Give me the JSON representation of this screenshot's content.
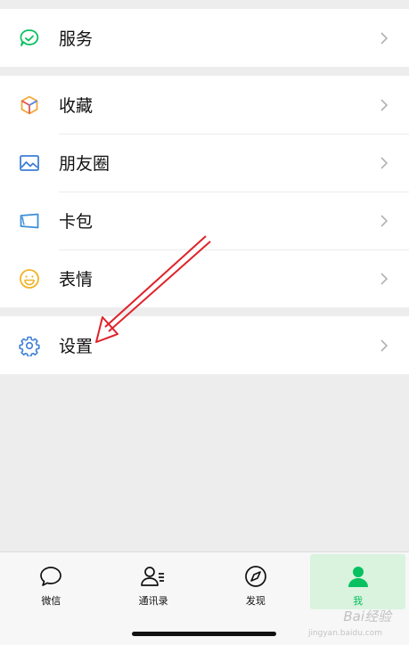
{
  "menu": {
    "service": {
      "label": "服务",
      "icon": "service-icon"
    },
    "favorites": {
      "label": "收藏",
      "icon": "favorites-cube-icon"
    },
    "moments": {
      "label": "朋友圈",
      "icon": "moments-image-icon"
    },
    "cards": {
      "label": "卡包",
      "icon": "card-wallet-icon"
    },
    "stickers": {
      "label": "表情",
      "icon": "smiley-icon"
    },
    "settings": {
      "label": "设置",
      "icon": "gear-icon"
    }
  },
  "tabbar": {
    "tabs": [
      {
        "label": "微信",
        "icon": "chat-bubble-icon"
      },
      {
        "label": "通讯录",
        "icon": "contacts-icon"
      },
      {
        "label": "发现",
        "icon": "compass-icon"
      },
      {
        "label": "我",
        "icon": "person-icon"
      }
    ],
    "active_tab": "我"
  },
  "watermark": {
    "text": "Bai经验",
    "sub": "jingyan.baidu.com"
  },
  "colors": {
    "accent_green": "#07c160",
    "annotation_red": "#e0222a",
    "background": "#ededed"
  }
}
